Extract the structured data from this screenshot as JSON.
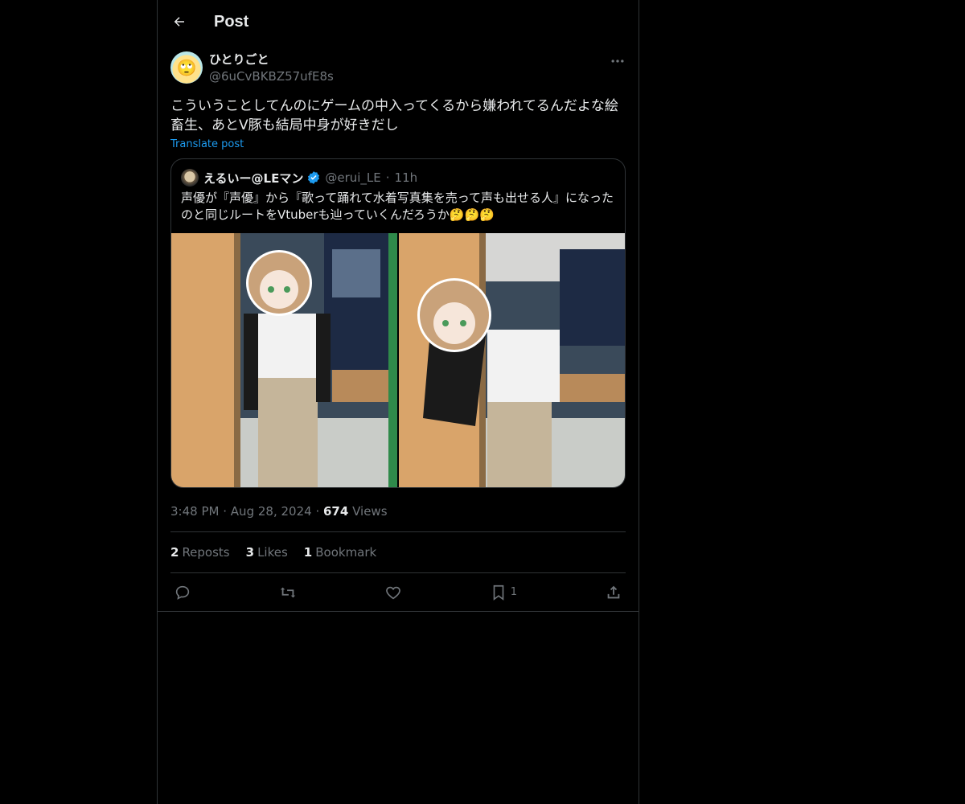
{
  "header": {
    "title": "Post"
  },
  "post": {
    "display_name": "ひとりごと",
    "handle": "@6uCvBKBZ57ufE8s",
    "avatar_emoji": "🙄",
    "text": "こういうことしてんのにゲームの中入ってくるから嫌われてるんだよな絵畜生、あとV豚も結局中身が好きだし",
    "translate_label": "Translate post",
    "time": "3:48 PM",
    "date": "Aug 28, 2024",
    "views_count": "674",
    "views_label": "Views",
    "sep": "·"
  },
  "quote": {
    "display_name": "えるいー@LEマン",
    "handle": "@erui_LE",
    "time": "11h",
    "text": "声優が『声優』から『歌って踊れて水着写真集を売って声も出せる人』になったのと同じルートをVtuberも辿っていくんだろうか🤔🤔🤔",
    "verified_color": "#1d9bf0"
  },
  "stats": {
    "reposts_count": "2",
    "reposts_label": "Reposts",
    "likes_count": "3",
    "likes_label": "Likes",
    "bookmarks_count": "1",
    "bookmarks_label": "Bookmark"
  },
  "actions": {
    "bookmark_count": "1"
  },
  "icons": [
    "back-arrow-icon",
    "more-icon",
    "verified-icon",
    "reply-icon",
    "repost-icon",
    "like-icon",
    "bookmark-icon",
    "share-icon"
  ]
}
